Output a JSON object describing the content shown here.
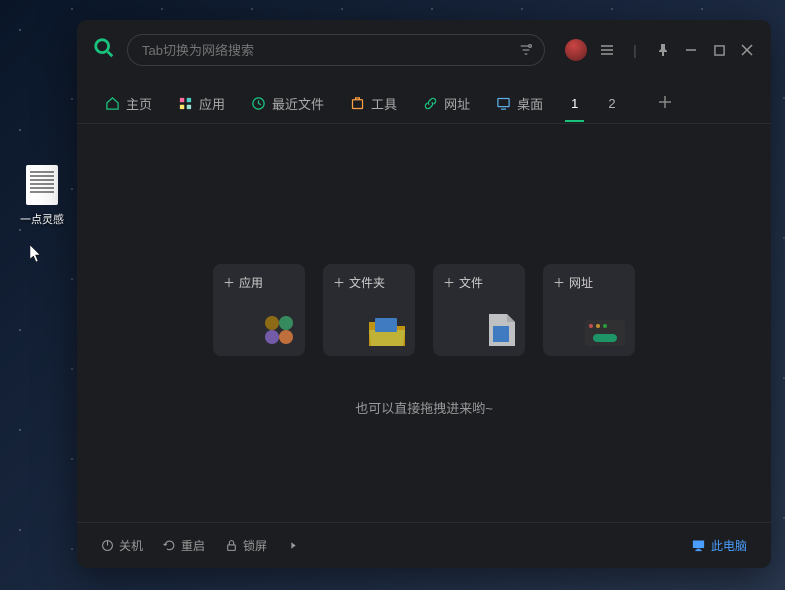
{
  "desktop": {
    "file_label": "一点灵感"
  },
  "search": {
    "placeholder": "Tab切换为网络搜索"
  },
  "tabs": {
    "home": "主页",
    "apps": "应用",
    "recent": "最近文件",
    "tools": "工具",
    "urls": "网址",
    "desktop": "桌面",
    "num1": "1",
    "num2": "2"
  },
  "cards": {
    "app": "应用",
    "folder": "文件夹",
    "file": "文件",
    "url": "网址"
  },
  "hint": "也可以直接拖拽进来哟~",
  "footer": {
    "shutdown": "关机",
    "restart": "重启",
    "lock": "锁屏",
    "pc": "此电脑"
  }
}
